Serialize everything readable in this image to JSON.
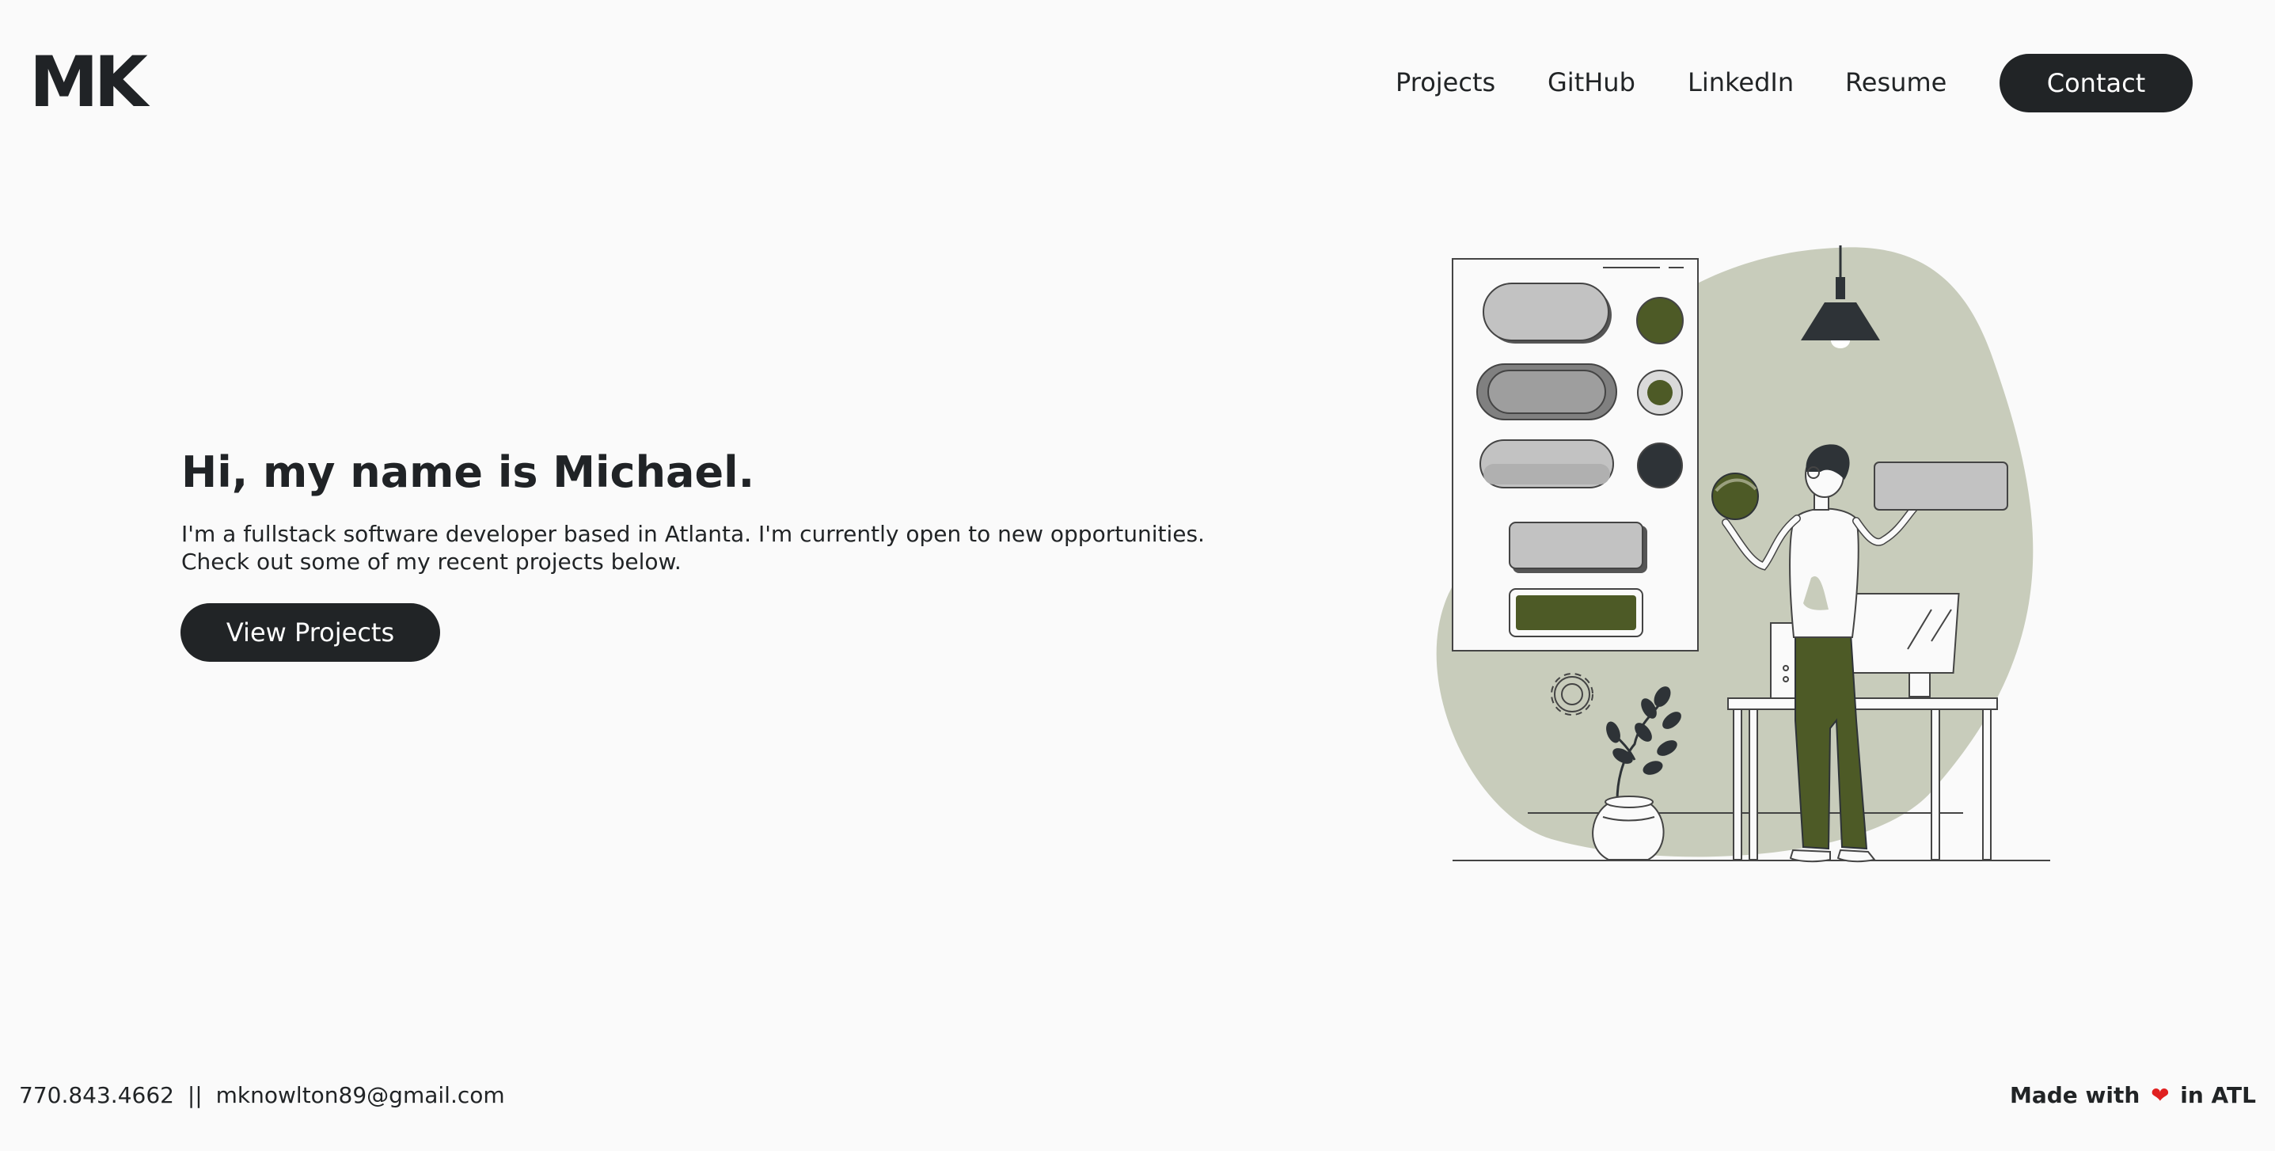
{
  "brand": {
    "logo_text": "MK"
  },
  "nav": {
    "items": [
      "Projects",
      "GitHub",
      "LinkedIn",
      "Resume"
    ],
    "contact_label": "Contact"
  },
  "hero": {
    "title": "Hi, my name is Michael.",
    "description": "I'm a fullstack software developer based in Atlanta. I'm currently open to new opportunities. Check out some of my recent projects below.",
    "cta_label": "View Projects"
  },
  "footer": {
    "phone": "770.843.4662",
    "separator": "||",
    "email": "mknowlton89@gmail.com",
    "made_with_prefix": "Made with",
    "heart_icon": "heart-icon",
    "made_with_suffix": "in ATL"
  },
  "colors": {
    "background": "#fafafa",
    "text": "#212426",
    "button_bg": "#212426",
    "blob": "#c8ccbb",
    "olive": "#4d5a26",
    "heart": "#e02020"
  }
}
